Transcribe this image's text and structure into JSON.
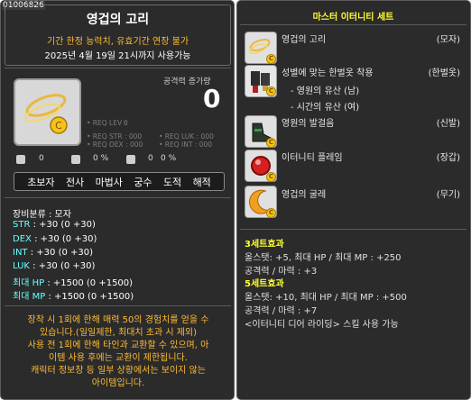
{
  "item": {
    "code": "01006826",
    "name": "영겁의 고리",
    "warning": "기간 한정 능력치, 유효기간 연장 불가",
    "expire": "2025년 4월 19일 21시까지 사용가능",
    "attack_label": "공격력 증가량",
    "attack_value": "0",
    "req": {
      "lev": "• REQ LEV :",
      "lev_val": "0",
      "str": "• REQ STR : 000",
      "luk": "• REQ LUK : 000",
      "dex": "• REQ DEX : 000",
      "int": "• REQ INT : 000"
    },
    "icon_pcts": [
      "0",
      "0 %",
      "0",
      "0 %"
    ],
    "jobs": [
      "초보자",
      "전사",
      "마법사",
      "궁수",
      "도적",
      "해적"
    ],
    "category": "장비분류 : 모자",
    "stats": [
      {
        "key": "STR",
        "val": ": +30 (0 +30)"
      },
      {
        "key": "DEX",
        "val": ": +30 (0 +30)"
      },
      {
        "key": "INT",
        "val": ": +30 (0 +30)"
      },
      {
        "key": "LUK",
        "val": ": +30 (0 +30)"
      },
      {
        "key": "최대 HP",
        "val": ": +1500 (0 +1500)"
      },
      {
        "key": "최대 MP",
        "val": ": +1500 (0 +1500)"
      }
    ],
    "description": [
      "장착 시 1회에 한해 매력 50의 경험치를 얻을 수",
      "있습니다.(일일제한, 최대치 초과 시 제외)",
      "사용 전 1회에 한해 타인과 교환할 수 있으며, 아",
      "이템 사용 후에는 교환이 제한됩니다.",
      "캐릭터 정보창 등 일부 상황에서는 보이지 않는",
      "아이템입니다."
    ]
  },
  "set": {
    "name": "마스터 이터니티 세트",
    "pieces": [
      {
        "name": "영겁의 고리",
        "slot": "(모자)",
        "sub": []
      },
      {
        "name": "성별에 맞는 한벌옷 착용",
        "slot": "(한벌옷)",
        "sub": [
          "- 영원의 유산 (남)",
          "- 시간의 유산 (여)"
        ]
      },
      {
        "name": "영원의 발걸음",
        "slot": "(신발)",
        "sub": []
      },
      {
        "name": "이터니티 플레임",
        "slot": "(장갑)",
        "sub": []
      },
      {
        "name": "영겁의 굴레",
        "slot": "(무기)",
        "sub": []
      }
    ],
    "effects": [
      {
        "title": "3세트효과",
        "lines": [
          "올스탯: +5, 최대 HP / 최대 MP : +250",
          "공격력 / 마력 : +3"
        ]
      },
      {
        "title": "5세트효과",
        "lines": [
          "올스탯: +10, 최대 HP / 최대 MP : +500",
          "공격력 / 마력 : +7",
          "<이터니티 디어 라이딩> 스킬 사용 가능"
        ]
      }
    ]
  },
  "colors": {
    "accent_yellow": "#ffff33",
    "warning_orange": "#ffbb33",
    "stat_cyan": "#66ffff",
    "panel_bg": "#2b2b2b"
  }
}
